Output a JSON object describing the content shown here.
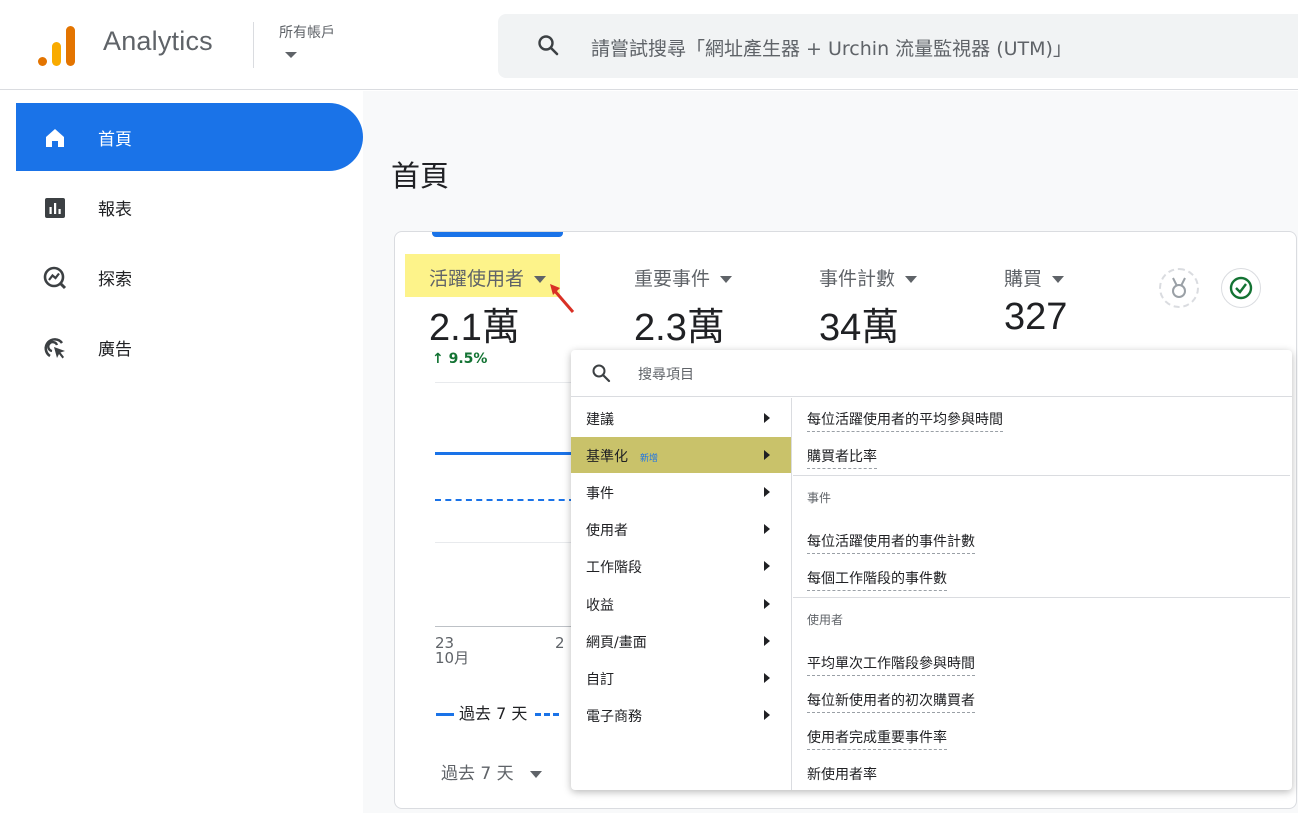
{
  "header": {
    "app_title": "Analytics",
    "account_label": "所有帳戶",
    "search_placeholder": "請嘗試搜尋「網址產生器 + Urchin 流量監視器 (UTM)」",
    "logo_icon": "analytics-logo-icon",
    "search_icon": "search-icon"
  },
  "sidebar": {
    "items": [
      {
        "label": "首頁",
        "icon": "home-icon",
        "active": true
      },
      {
        "label": "報表",
        "icon": "bar-chart-icon",
        "active": false
      },
      {
        "label": "探索",
        "icon": "explore-icon",
        "active": false
      },
      {
        "label": "廣告",
        "icon": "ads-cursor-icon",
        "active": false
      }
    ]
  },
  "main": {
    "page_title": "首頁",
    "metrics": [
      {
        "label": "活躍使用者",
        "value": "2.1萬",
        "highlighted": true,
        "change": "↑ 9.5%"
      },
      {
        "label": "重要事件",
        "value": "2.3萬"
      },
      {
        "label": "事件計數",
        "value": "34萬"
      },
      {
        "label": "購買",
        "value": "327"
      }
    ],
    "chart": {
      "x_tick_day": "23",
      "x_tick_month": "10月",
      "x_tick_second": "2"
    },
    "legend_current": "過去 7 天",
    "range_label": "過去 7 天",
    "badges": {
      "medal_icon": "medal-icon",
      "check_icon": "check-circle-icon"
    }
  },
  "menu": {
    "search_placeholder": "搜尋項目",
    "categories": [
      {
        "label": "建議",
        "selected": false
      },
      {
        "label": "基準化",
        "selected": true,
        "badge": "新增"
      },
      {
        "label": "事件",
        "selected": false
      },
      {
        "label": "使用者",
        "selected": false
      },
      {
        "label": "工作階段",
        "selected": false
      },
      {
        "label": "收益",
        "selected": false
      },
      {
        "label": "網頁/畫面",
        "selected": false
      },
      {
        "label": "自訂",
        "selected": false
      },
      {
        "label": "電子商務",
        "selected": false
      }
    ],
    "options_top": [
      "每位活躍使用者的平均參與時間",
      "購買者比率"
    ],
    "group_events": {
      "header": "事件",
      "options": [
        "每位活躍使用者的事件計數",
        "每個工作階段的事件數"
      ]
    },
    "group_users": {
      "header": "使用者",
      "options": [
        "平均單次工作階段參與時間",
        "每位新使用者的初次購買者",
        "使用者完成重要事件率",
        "新使用者率"
      ]
    }
  },
  "colors": {
    "accent_blue": "#1a73e8",
    "highlight_yellow": "#fdf38a",
    "selected_menu": "#c9c26a",
    "positive_green": "#137333",
    "annotation_red": "#d93025"
  }
}
